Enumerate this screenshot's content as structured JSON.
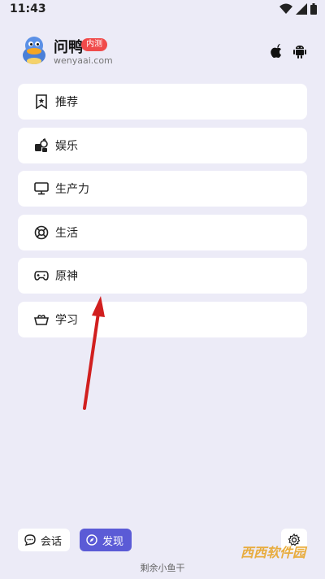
{
  "status_bar": {
    "time": "11:43"
  },
  "header": {
    "app_name": "问鸭",
    "badge": "内测",
    "url": "wenyaai.com"
  },
  "platforms": [
    {
      "icon": "apple-icon"
    },
    {
      "icon": "android-icon"
    }
  ],
  "menu": {
    "items": [
      {
        "label": "推荐",
        "icon": "bookmark-star-icon"
      },
      {
        "label": "娱乐",
        "icon": "entertainment-icon"
      },
      {
        "label": "生产力",
        "icon": "monitor-icon"
      },
      {
        "label": "生活",
        "icon": "lifebuoy-icon"
      },
      {
        "label": "原神",
        "icon": "gamepad-icon"
      },
      {
        "label": "学习",
        "icon": "study-icon"
      }
    ]
  },
  "bottom_bar": {
    "chat_label": "会话",
    "discover_label": "发现"
  },
  "footer": {
    "text": "剩余小鱼干"
  },
  "watermark": {
    "text": "西西软件园"
  },
  "colors": {
    "accent": "#5B5BD6",
    "badge": "#F04A4A",
    "background": "#ECEBF7",
    "arrow": "#D11F1F"
  }
}
